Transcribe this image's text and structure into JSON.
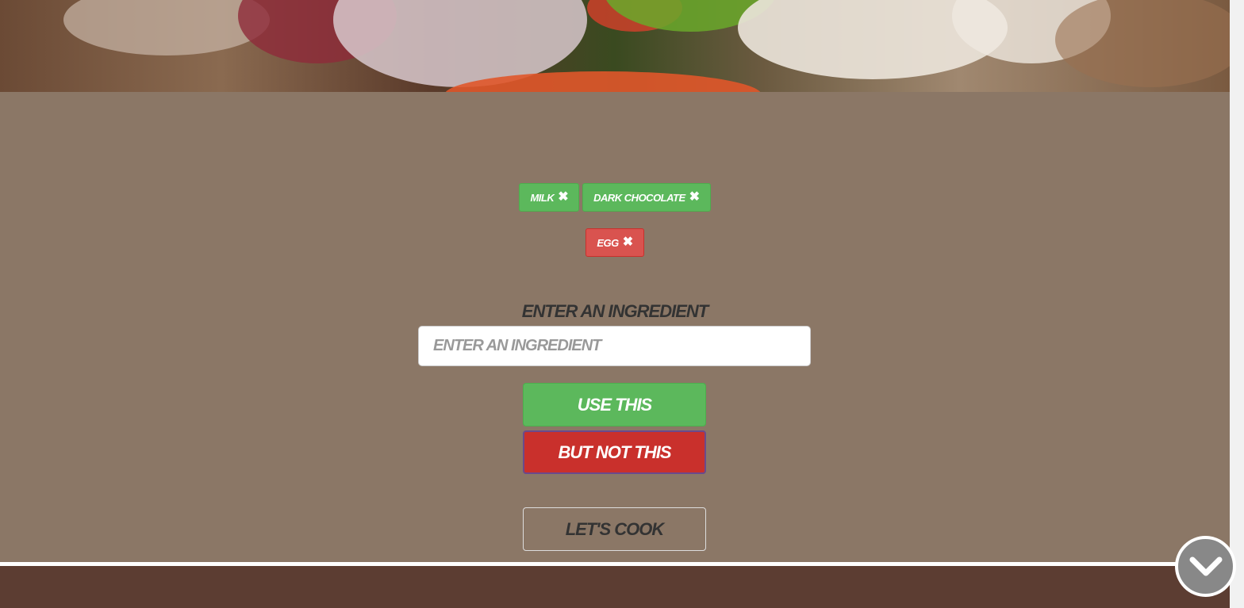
{
  "tags": {
    "included": [
      {
        "label": "Milk",
        "remove_icon": "close-icon"
      },
      {
        "label": "Dark Chocolate",
        "remove_icon": "close-icon"
      }
    ],
    "excluded": [
      {
        "label": "Egg",
        "remove_icon": "close-icon"
      }
    ]
  },
  "form": {
    "label": "Enter an ingredient",
    "input_placeholder": "Enter an ingredient",
    "input_value": ""
  },
  "buttons": {
    "use_label": "Use this",
    "exclude_label": "But not this",
    "cook_label": "Let's cook"
  },
  "scroll_icon": "chevron-down-icon",
  "colors": {
    "background": "#8b7766",
    "include": "#5cb85c",
    "exclude": "#d9534f",
    "exclude_button": "#c9302c",
    "footer": "#5c3d32"
  }
}
